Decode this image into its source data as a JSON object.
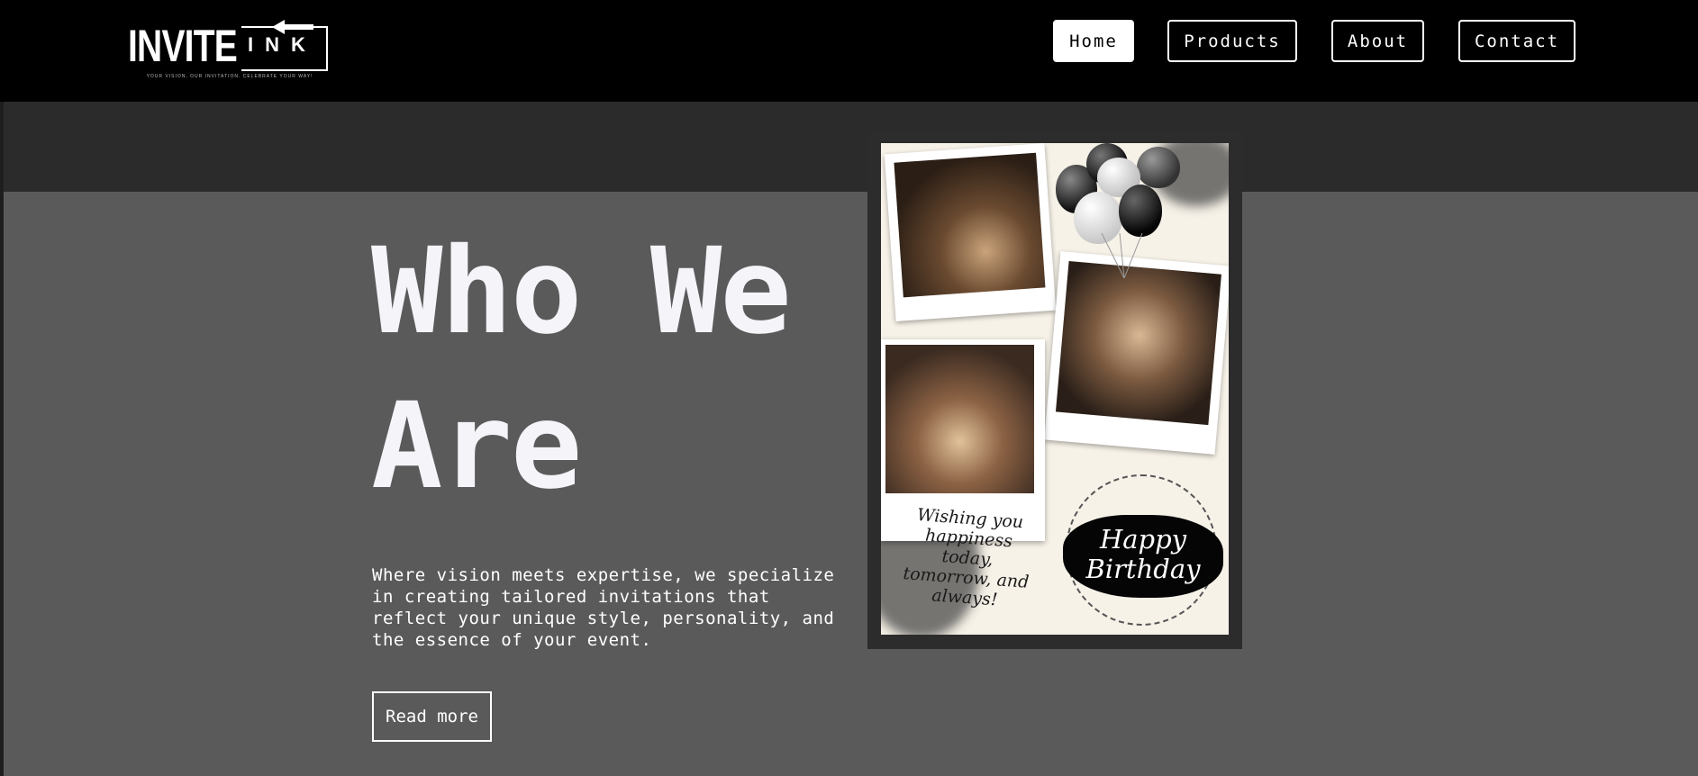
{
  "brand": {
    "logo_main": "INVITE",
    "logo_sub": "INK",
    "tagline": "YOUR VISION, OUR INVITATION. CELEBRATE YOUR WAY!"
  },
  "nav": {
    "items": [
      {
        "label": "Home",
        "active": true
      },
      {
        "label": "Products",
        "active": false
      },
      {
        "label": "About",
        "active": false
      },
      {
        "label": "Contact",
        "active": false
      }
    ]
  },
  "hero": {
    "title": "Who We Are",
    "description": "Where vision meets expertise, we specialize in creating tailored invitations that reflect your unique style, personality, and the essence of your event.",
    "button_label": "Read more"
  },
  "card": {
    "wish_text": "Wishing you happiness today, tomorrow, and always!",
    "greeting": "Happy Birthday"
  },
  "colors": {
    "navbar": "#000000",
    "band": "#2b2b2b",
    "page_bg": "#5b5a5b",
    "text": "#ffffff",
    "title": "#f4f4f9"
  }
}
